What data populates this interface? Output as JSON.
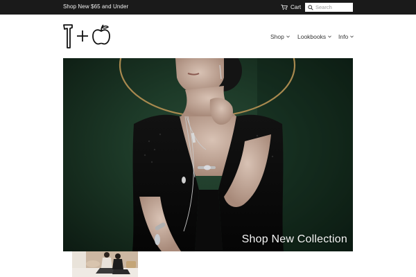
{
  "topbar": {
    "promo_text": "Shop New $65 and Under",
    "cart_label": "Cart",
    "search_placeholder": "Search"
  },
  "logo": {
    "alt": "Axe + Apple logo"
  },
  "nav": {
    "items": [
      {
        "label": "Shop",
        "icon": "chevron-down-icon"
      },
      {
        "label": "Lookbooks",
        "icon": "chevron-down-icon"
      },
      {
        "label": "Info",
        "icon": "chevron-down-icon"
      }
    ]
  },
  "hero": {
    "caption": "Shop New Collection"
  },
  "colors": {
    "topbar_bg": "#1a1a1a",
    "hero_bg": "#1d3a28",
    "text": "#333333"
  }
}
